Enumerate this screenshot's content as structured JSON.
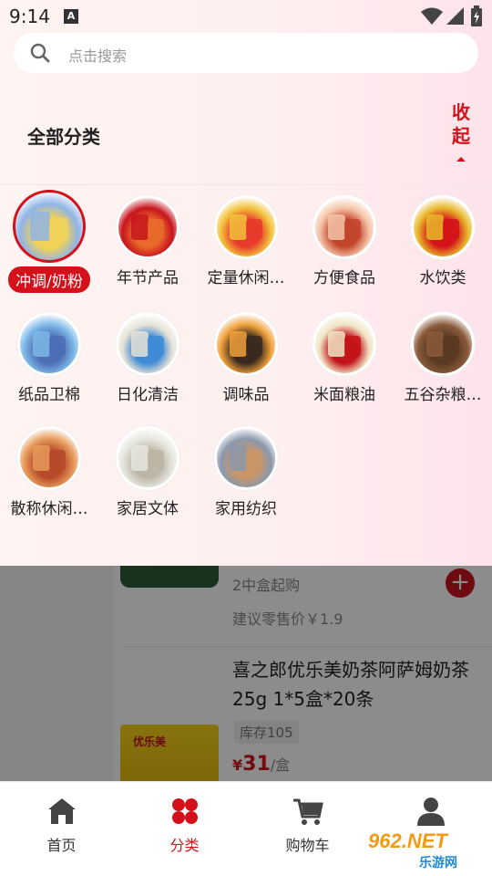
{
  "status_bar": {
    "time": "9:14",
    "a_badge": "A"
  },
  "search": {
    "placeholder": "点击搜索"
  },
  "section": {
    "title": "全部分类",
    "collapse_label": "收起"
  },
  "categories": [
    {
      "label": "冲调/奶粉",
      "active": true,
      "color1": "#8fb4e6",
      "color2": "#f0d25a"
    },
    {
      "label": "年节产品",
      "active": false,
      "color1": "#c8141e",
      "color2": "#e86a2a"
    },
    {
      "label": "定量休闲…",
      "active": false,
      "color1": "#f2c23a",
      "color2": "#e83b2c"
    },
    {
      "label": "方便食品",
      "active": false,
      "color1": "#f5c4a8",
      "color2": "#c2462c"
    },
    {
      "label": "水饮类",
      "active": false,
      "color1": "#e8b82a",
      "color2": "#d4141a"
    },
    {
      "label": "纸品卫棉",
      "active": false,
      "color1": "#7db8e8",
      "color2": "#4e6fb6"
    },
    {
      "label": "日化清洁",
      "active": false,
      "color1": "#e6e2d6",
      "color2": "#3f8bd6"
    },
    {
      "label": "调味品",
      "active": false,
      "color1": "#f0a03a",
      "color2": "#3a2a1e"
    },
    {
      "label": "米面粮油",
      "active": false,
      "color1": "#f0e4c4",
      "color2": "#c4141a"
    },
    {
      "label": "五谷杂粮…",
      "active": false,
      "color1": "#8a5a3a",
      "color2": "#5a3a22"
    },
    {
      "label": "散称休闲…",
      "active": false,
      "color1": "#e69a5a",
      "color2": "#b64a2a"
    },
    {
      "label": "家居文体",
      "active": false,
      "color1": "#e6e6de",
      "color2": "#bdb6a6"
    },
    {
      "label": "家用纺织",
      "active": false,
      "color1": "#8a98ac",
      "color2": "#c9966a"
    }
  ],
  "background_products": {
    "min_order": "2中盒起购",
    "retail_price": "建议零售价￥1.9",
    "product_title": "喜之郎优乐美奶茶阿萨姆奶茶25g 1*5盒*20条",
    "stock": "库存105",
    "price_symbol": "¥",
    "price_value": "31",
    "price_unit": "/盒",
    "product_logo": "优乐美"
  },
  "bottom_nav": [
    {
      "label": "首页",
      "icon": "home-icon",
      "active": false
    },
    {
      "label": "分类",
      "icon": "category-icon",
      "active": true
    },
    {
      "label": "购物车",
      "icon": "cart-icon",
      "active": false
    },
    {
      "label": "",
      "icon": "profile-icon",
      "active": false
    }
  ],
  "watermark": {
    "brand": "962.NET",
    "site": "乐游网"
  },
  "colors": {
    "accent": "#d4111a",
    "panel_bg": "#fff1f1"
  }
}
